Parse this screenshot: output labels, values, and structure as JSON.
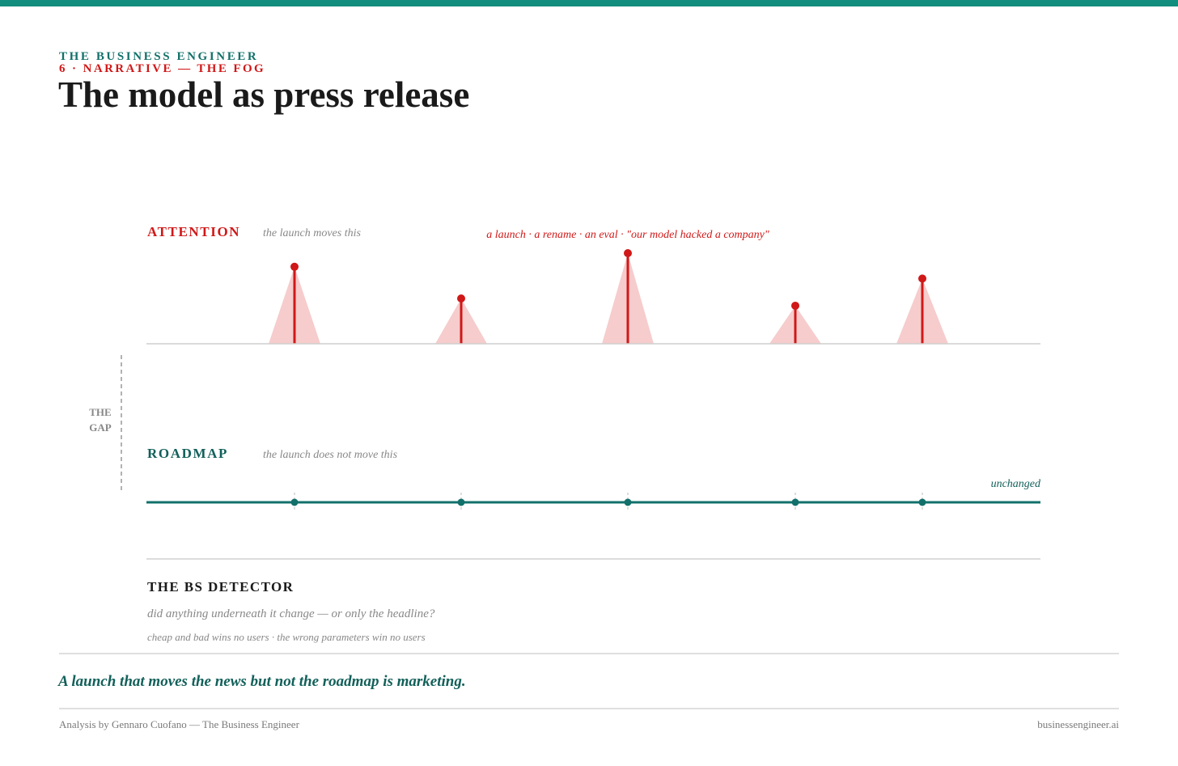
{
  "header": {
    "brand": "THE BUSINESS ENGINEER",
    "section": "6 · NARRATIVE — THE FOG",
    "title": "The model as press release"
  },
  "attention": {
    "label": "ATTENTION",
    "note": "the launch moves this",
    "events_caption": "a launch · a rename · an eval · \"our model hacked a company\"",
    "spike_levels": [
      0.85,
      0.5,
      1.0,
      0.42,
      0.72
    ]
  },
  "gap": {
    "line1": "THE",
    "line2": "GAP"
  },
  "roadmap": {
    "label": "ROADMAP",
    "note": "the launch does not move this",
    "status": "unchanged"
  },
  "bs_detector": {
    "title": "THE BS DETECTOR",
    "question": "did anything underneath it change — or only the headline?",
    "note": "cheap and bad wins no users · the wrong parameters win no users"
  },
  "caption": "A launch that moves the news but not the roadmap is marketing.",
  "footer": {
    "author": "Analysis by Gennaro Cuofano — The Business Engineer",
    "site": "businessengineer.ai"
  },
  "colors": {
    "teal": "#12706a",
    "red": "#d01818",
    "spike_fill": "#f6cccc",
    "gray_text": "#888888"
  }
}
